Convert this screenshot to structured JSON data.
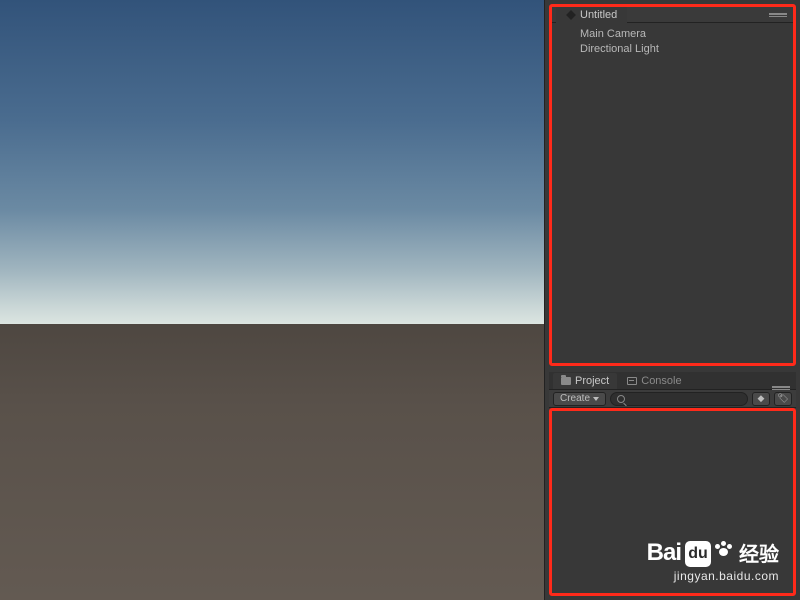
{
  "scene_tab": {
    "title": "Untitled"
  },
  "hierarchy": {
    "items": [
      {
        "label": "Main Camera"
      },
      {
        "label": "Directional Light"
      }
    ]
  },
  "project": {
    "tabs": [
      {
        "label": "Project",
        "active": true
      },
      {
        "label": "Console",
        "active": false
      }
    ],
    "toolbar": {
      "create_label": "Create",
      "search_placeholder": ""
    }
  },
  "watermark": {
    "brand_left": "Bai",
    "brand_box": "du",
    "brand_cn": "经验",
    "url": "jingyan.baidu.com"
  },
  "colors": {
    "highlight_border": "#ff2a1a",
    "panel_bg": "#383838"
  }
}
